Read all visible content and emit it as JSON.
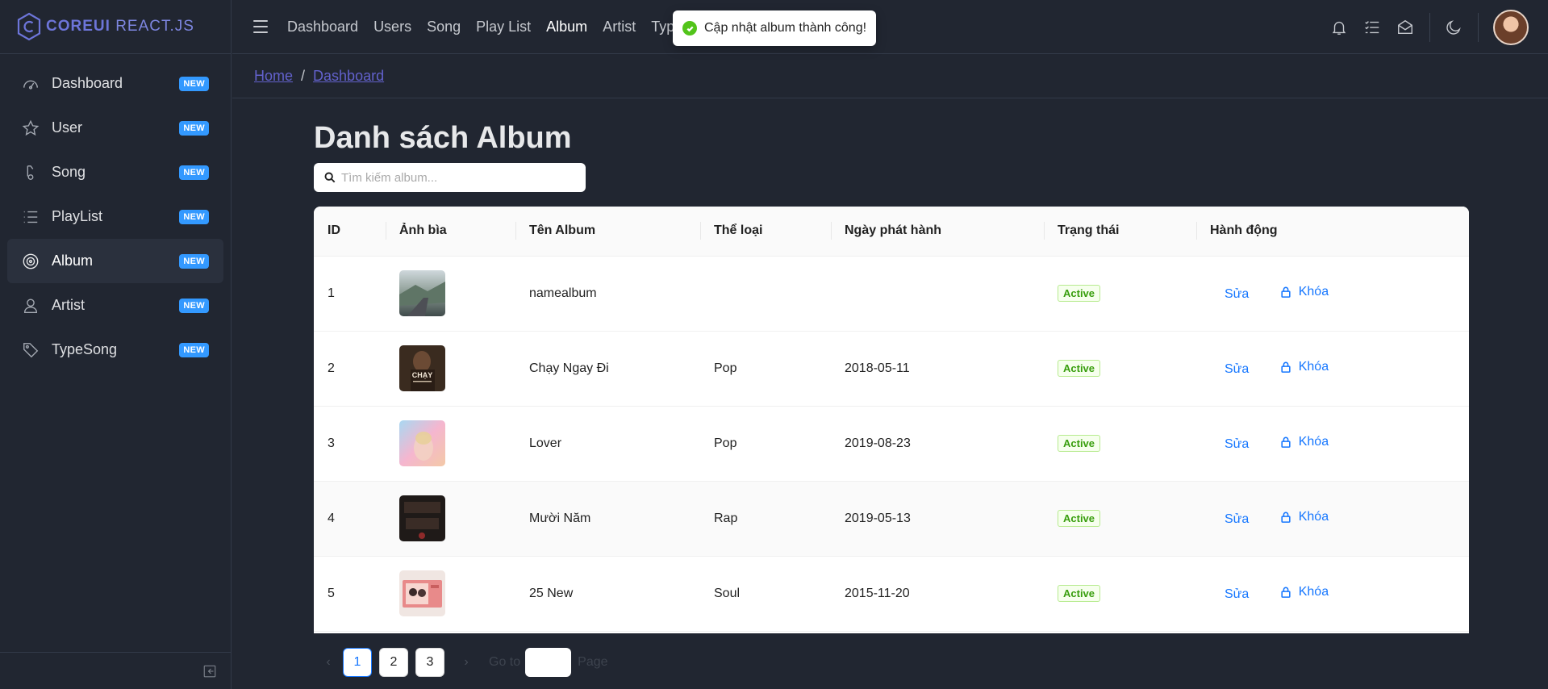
{
  "brand": {
    "logo_bold": "COREUI",
    "logo_light": "REACT.JS"
  },
  "sidebar": {
    "items": [
      {
        "label": "Dashboard",
        "badge": "NEW",
        "icon": "speedometer-icon"
      },
      {
        "label": "User",
        "badge": "NEW",
        "icon": "star-icon"
      },
      {
        "label": "Song",
        "badge": "NEW",
        "icon": "music-note-icon"
      },
      {
        "label": "PlayList",
        "badge": "NEW",
        "icon": "list-icon"
      },
      {
        "label": "Album",
        "badge": "NEW",
        "icon": "disc-icon",
        "active": true
      },
      {
        "label": "Artist",
        "badge": "NEW",
        "icon": "user-icon"
      },
      {
        "label": "TypeSong",
        "badge": "NEW",
        "icon": "tag-icon"
      }
    ]
  },
  "header": {
    "nav": [
      "Dashboard",
      "Users",
      "Song",
      "Play List",
      "Album",
      "Artist",
      "Typy"
    ],
    "active_nav": "Album",
    "icons": [
      "bell-icon",
      "task-list-icon",
      "envelope-icon",
      "moon-icon"
    ]
  },
  "toast": {
    "message": "Cập nhật album thành công!",
    "status_color": "#52c41a"
  },
  "breadcrumb": {
    "home": "Home",
    "separator": "/",
    "current": "Dashboard"
  },
  "main": {
    "title": "Danh sách Album",
    "search_placeholder": "Tìm kiếm album..."
  },
  "table": {
    "columns": [
      "ID",
      "Ảnh bìa",
      "Tên Album",
      "Thể loại",
      "Ngày phát hành",
      "Trạng thái",
      "Hành động"
    ],
    "rows": [
      {
        "id": "1",
        "name": "namealbum",
        "genre": "",
        "date": "",
        "status": "Active",
        "edit": "Sửa",
        "lock": "Khóa"
      },
      {
        "id": "2",
        "name": "Chạy Ngay Đi",
        "genre": "Pop",
        "date": "2018-05-11",
        "status": "Active",
        "edit": "Sửa",
        "lock": "Khóa"
      },
      {
        "id": "3",
        "name": "Lover",
        "genre": "Pop",
        "date": "2019-08-23",
        "status": "Active",
        "edit": "Sửa",
        "lock": "Khóa"
      },
      {
        "id": "4",
        "name": "Mười Năm",
        "genre": "Rap",
        "date": "2019-05-13",
        "status": "Active",
        "edit": "Sửa",
        "lock": "Khóa"
      },
      {
        "id": "5",
        "name": "25 New",
        "genre": "Soul",
        "date": "2015-11-20",
        "status": "Active",
        "edit": "Sửa",
        "lock": "Khóa"
      }
    ]
  },
  "pagination": {
    "pages": [
      "1",
      "2",
      "3"
    ],
    "current": "1",
    "prev": "‹",
    "next": "›",
    "goto_label": "Go to",
    "page_label": "Page"
  },
  "colors": {
    "accent": "#1677ff",
    "badge": "#3399ff",
    "brand": "#6d75d9",
    "link": "#6261cc"
  }
}
